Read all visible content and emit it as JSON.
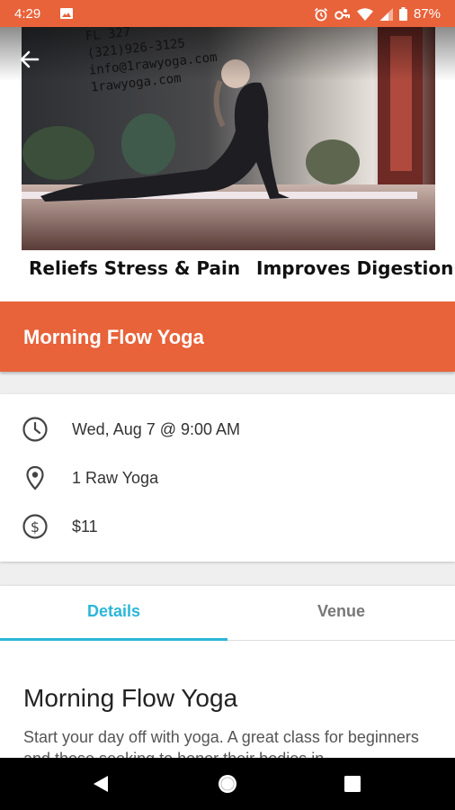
{
  "status_bar": {
    "time": "4:29",
    "battery": "87%",
    "icons": [
      "photo-icon",
      "alarm-icon",
      "key-icon",
      "wifi-icon",
      "signal-icon",
      "battery-icon"
    ]
  },
  "hero": {
    "contact_lines": [
      "FL 327",
      "(321)926-3125",
      "info@1rawyoga.com",
      "1rawyoga.com"
    ],
    "caption_left": "Reliefs Stress & Pain",
    "caption_right": "Improves Digestion",
    "back_icon": "arrow-back-icon"
  },
  "event": {
    "title": "Morning Flow Yoga",
    "datetime": "Wed, Aug 7 @ 9:00 AM",
    "venue": "1 Raw Yoga",
    "price": "$11",
    "icons": {
      "datetime": "clock-icon",
      "venue": "location-pin-icon",
      "price": "dollar-icon"
    }
  },
  "tabs": [
    {
      "label": "Details",
      "active": true
    },
    {
      "label": "Venue",
      "active": false
    }
  ],
  "details": {
    "heading": "Morning Flow Yoga",
    "description": "Start your day off with yoga. A great class for beginners and those seeking to honor their bodies in"
  },
  "colors": {
    "accent": "#e8623a",
    "tab_active": "#2bb6d8",
    "nav_bar": "#000000"
  },
  "nav": {
    "icons": [
      "back-triangle-icon",
      "home-circle-icon",
      "recents-square-icon"
    ]
  }
}
